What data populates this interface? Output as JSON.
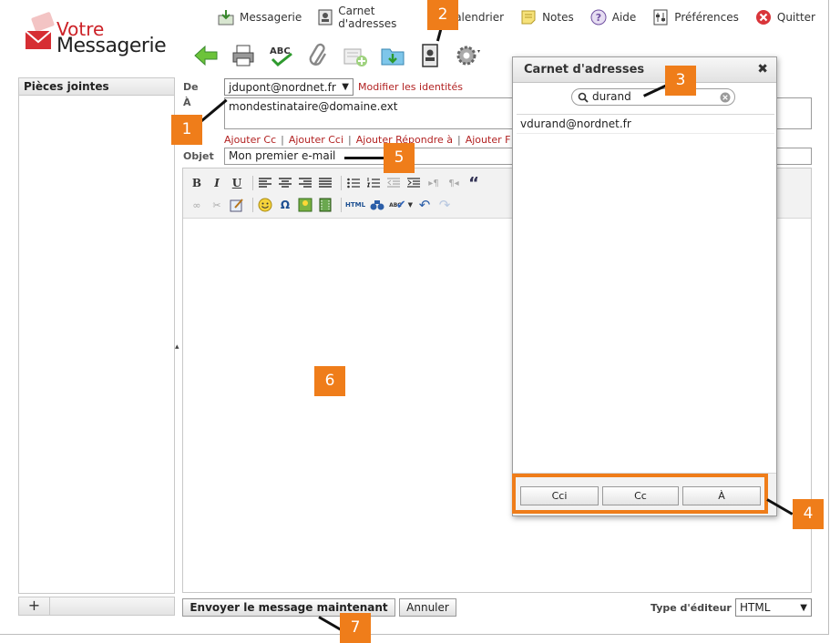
{
  "brand": {
    "line1": "Votre",
    "line2": "Messagerie",
    "accent_color": "#cc2127"
  },
  "topnav": [
    {
      "label": "Messagerie",
      "icon": "inbox-icon"
    },
    {
      "label": "Carnet d'adresses",
      "icon": "addressbook-icon"
    },
    {
      "label": "Calendrier",
      "icon": "calendar-icon"
    },
    {
      "label": "Notes",
      "icon": "notes-icon"
    },
    {
      "label": "Aide",
      "icon": "help-icon"
    },
    {
      "label": "Préférences",
      "icon": "preferences-icon"
    },
    {
      "label": "Quitter",
      "icon": "quit-icon"
    }
  ],
  "toolbar": [
    "back-arrow-icon",
    "print-icon",
    "spellcheck-icon",
    "attach-icon",
    "signature-icon",
    "save-folder-icon",
    "addressbook-icon",
    "settings-gear-icon"
  ],
  "left_panel": {
    "title": "Pièces jointes",
    "add_label": "+"
  },
  "compose": {
    "from_label": "De",
    "from_value": "jdupont@nordnet.fr",
    "modify_identities": "Modifier les identités",
    "to_label": "À",
    "to_value": "mondestinataire@domaine.ext",
    "add_links": [
      "Ajouter Cc",
      "Ajouter Cci",
      "Ajouter Répondre à",
      "Ajouter F"
    ],
    "subject_label": "Objet",
    "subject_value": "Mon premier e-mail"
  },
  "editor_toolbar": {
    "bold": "B",
    "italic": "I",
    "underline": "U",
    "html": "HTML",
    "omega": "Ω",
    "quote": "“",
    "spell": "ABC"
  },
  "footer": {
    "send_label": "Envoyer le message maintenant",
    "cancel_label": "Annuler",
    "editor_type_label": "Type d'éditeur",
    "editor_type_value": "HTML"
  },
  "dialog": {
    "title": "Carnet d'adresses",
    "close_symbol": "✖",
    "search_value": "durand",
    "results": [
      "vdurand@nordnet.fr"
    ],
    "buttons": [
      "Cci",
      "Cc",
      "À"
    ]
  },
  "callouts": [
    "1",
    "2",
    "3",
    "4",
    "5",
    "6",
    "7"
  ],
  "callout_color": "#ef7d1a"
}
